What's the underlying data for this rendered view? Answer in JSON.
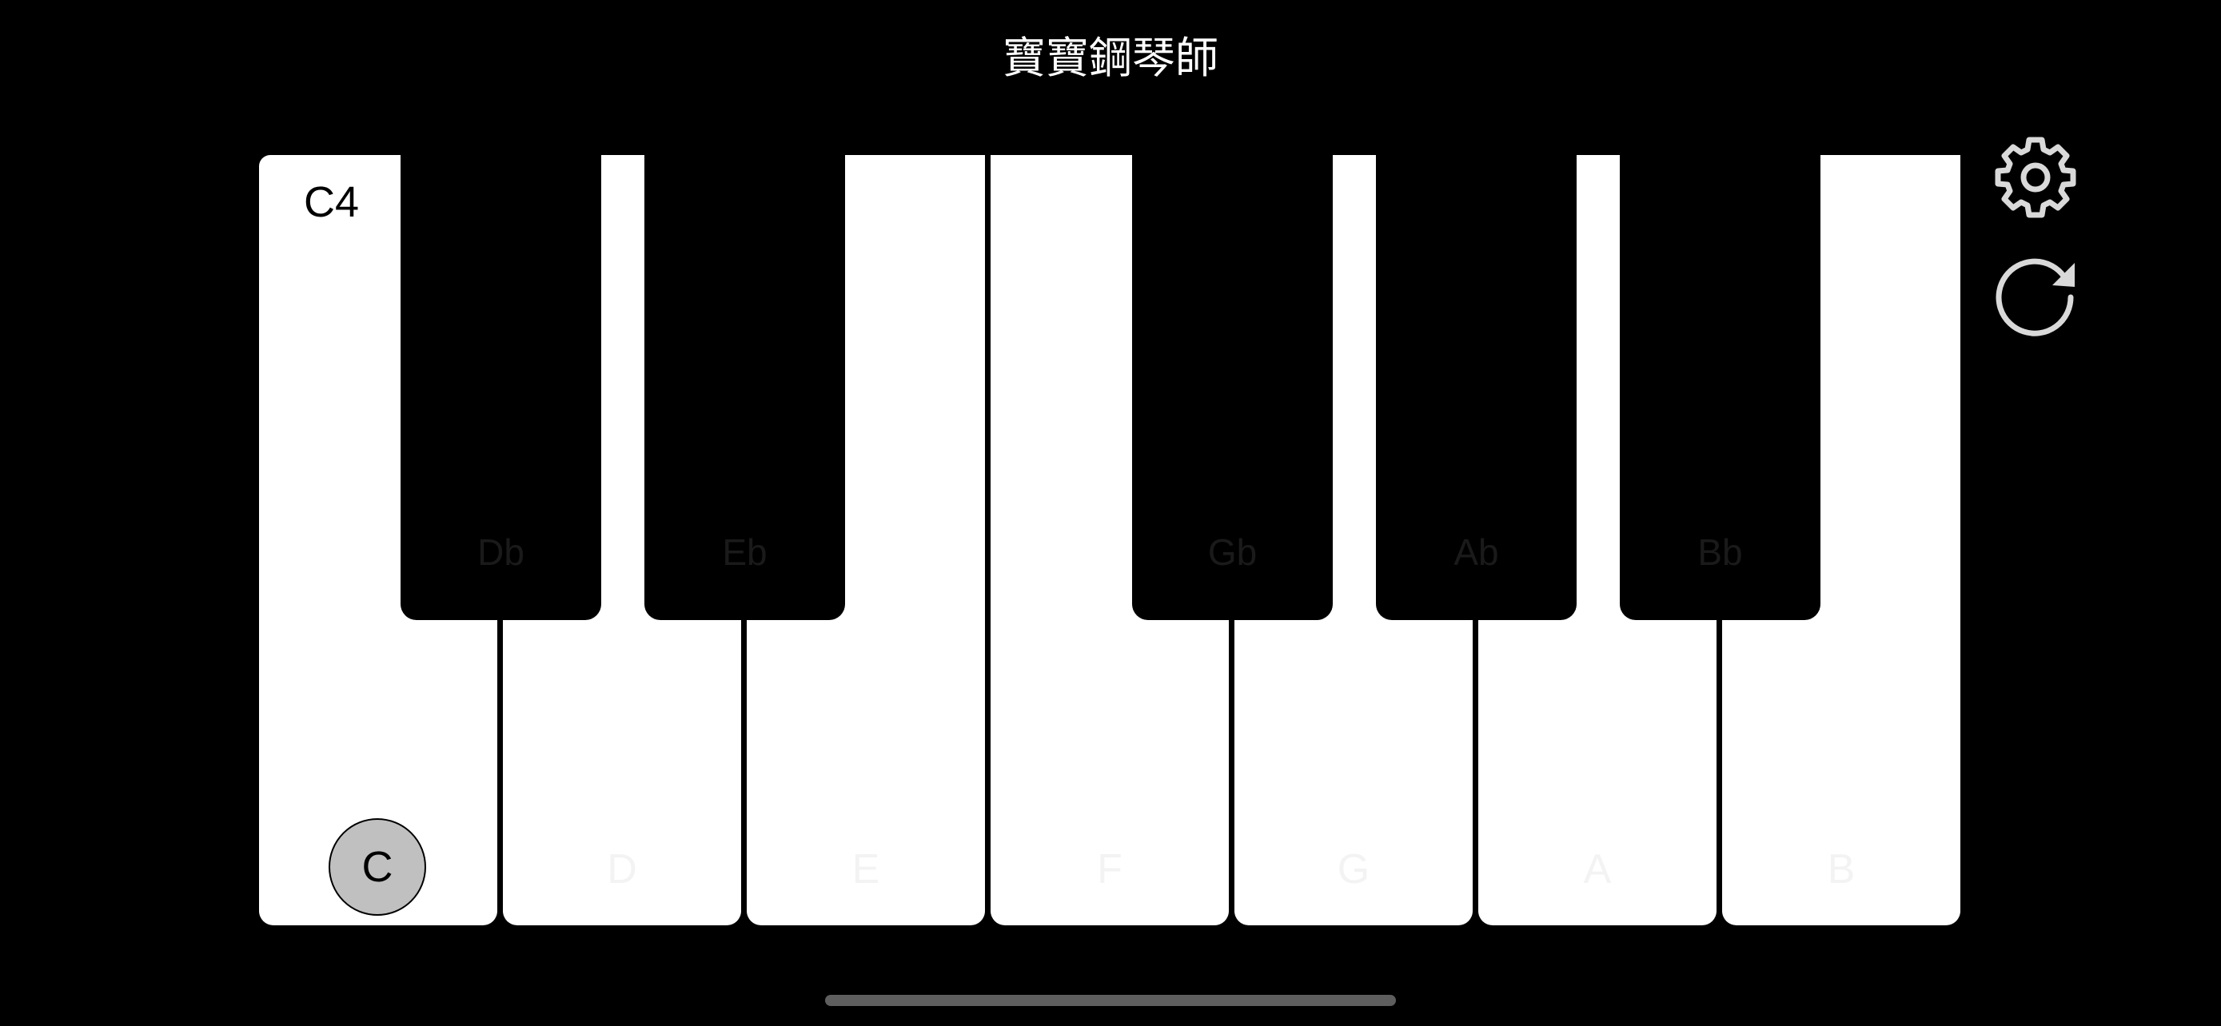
{
  "app": {
    "title": "寶寶鋼琴師"
  },
  "keyboard": {
    "octave_label": "C4",
    "active_note": "C",
    "white_keys": [
      {
        "note": "C"
      },
      {
        "note": "D"
      },
      {
        "note": "E"
      },
      {
        "note": "F"
      },
      {
        "note": "G"
      },
      {
        "note": "A"
      },
      {
        "note": "B"
      }
    ],
    "black_keys": [
      {
        "note": "Db"
      },
      {
        "note": "Eb"
      },
      {
        "note": "Gb"
      },
      {
        "note": "Ab"
      },
      {
        "note": "Bb"
      }
    ]
  },
  "controls": {
    "settings_icon": "gear-icon",
    "reload_icon": "reload-icon"
  },
  "colors": {
    "background": "#000000",
    "white_key": "#ffffff",
    "black_key": "#000000",
    "active_marker": "#c0c0c0",
    "icon": "#d9d9d9"
  }
}
